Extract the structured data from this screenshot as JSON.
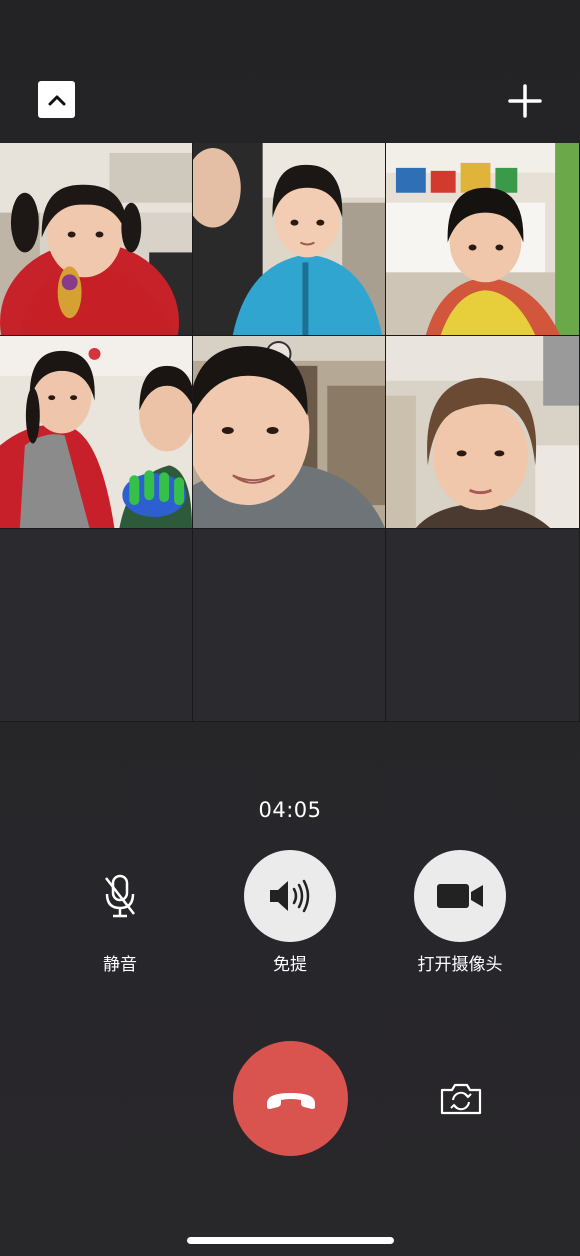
{
  "call": {
    "timer": "04:05"
  },
  "controls": {
    "mute_label": "静音",
    "speaker_label": "免提",
    "camera_label": "打开摄像头"
  },
  "icons": {
    "minimize": "chevron-up-icon",
    "add_participant": "plus-icon",
    "mute": "microphone-off-icon",
    "speaker": "speaker-icon",
    "camera": "video-camera-icon",
    "end_call": "phone-hangup-icon",
    "flip_camera": "camera-switch-icon"
  },
  "colors": {
    "background": "#242326",
    "end_call": "#d9534f",
    "control_circle": "#ebebeb"
  },
  "participants": [
    {
      "tile": 1,
      "video": true
    },
    {
      "tile": 2,
      "video": true
    },
    {
      "tile": 3,
      "video": true
    },
    {
      "tile": 4,
      "video": true
    },
    {
      "tile": 5,
      "video": true
    },
    {
      "tile": 6,
      "video": true
    },
    {
      "tile": 7,
      "video": false
    },
    {
      "tile": 8,
      "video": false
    },
    {
      "tile": 9,
      "video": false
    }
  ]
}
